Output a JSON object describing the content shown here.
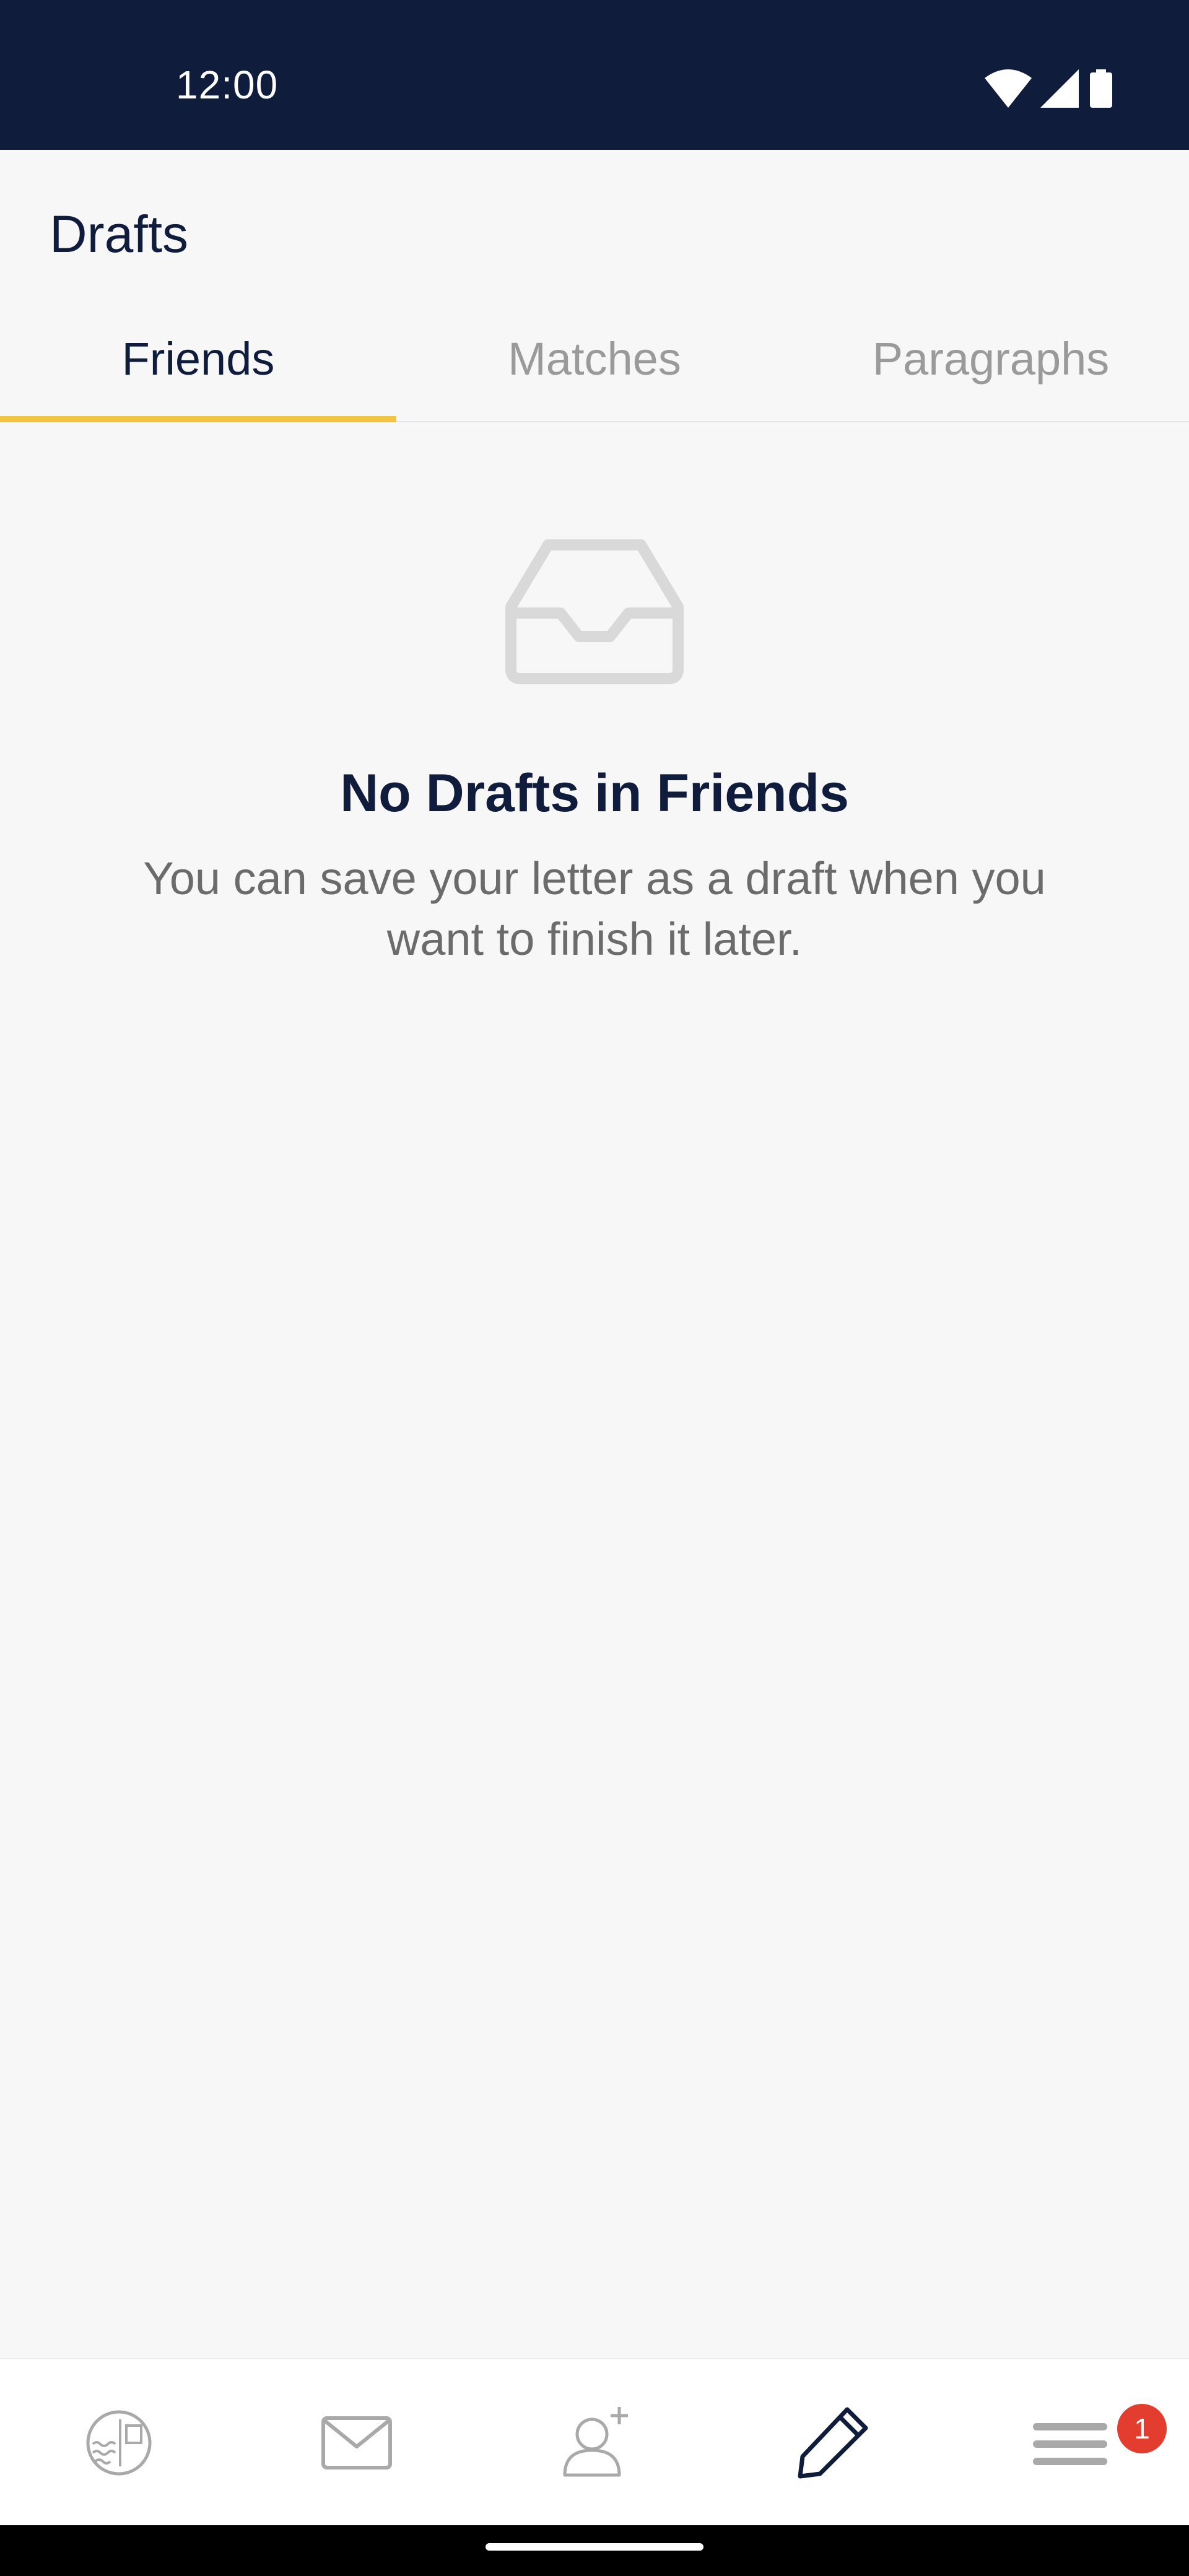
{
  "status_bar": {
    "time": "12:00"
  },
  "header": {
    "title": "Drafts"
  },
  "tabs": [
    {
      "label": "Friends",
      "active": true
    },
    {
      "label": "Matches",
      "active": false
    },
    {
      "label": "Paragraphs",
      "active": false
    }
  ],
  "empty_state": {
    "icon": "inbox-icon",
    "title": "No Drafts in Friends",
    "description": "You can save your letter as a draft when you want to finish it later."
  },
  "bottom_nav": {
    "items": [
      {
        "icon": "postcard-stamp-icon",
        "active": false
      },
      {
        "icon": "envelope-icon",
        "active": false
      },
      {
        "icon": "add-person-icon",
        "active": false
      },
      {
        "icon": "pencil-icon",
        "active": true
      },
      {
        "icon": "menu-icon",
        "active": false,
        "badge": "1"
      }
    ]
  },
  "colors": {
    "navy": "#0f1c3b",
    "accent": "#f4c542",
    "inactive": "#9a9a9a",
    "badge": "#e23d2e"
  }
}
